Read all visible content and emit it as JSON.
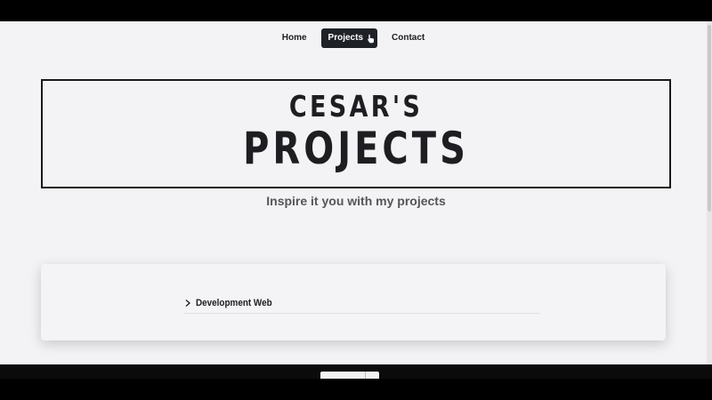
{
  "nav": {
    "items": [
      {
        "label": "Home"
      },
      {
        "label": "Projects"
      },
      {
        "label": "Contact"
      }
    ]
  },
  "hero": {
    "line1": "CESAR'S",
    "line2": "PROJECTS"
  },
  "subtitle": "Inspire it you with my projects",
  "projects": {
    "items": [
      {
        "label": "Development Web"
      }
    ]
  },
  "colors": {
    "background": "#f3f3f5",
    "active_nav": "#1e2126",
    "text": "#1e1e22",
    "subtitle": "#555558"
  },
  "icons": {
    "cursor": "hand-pointer-icon",
    "accordion": "chevron-right-icon"
  }
}
